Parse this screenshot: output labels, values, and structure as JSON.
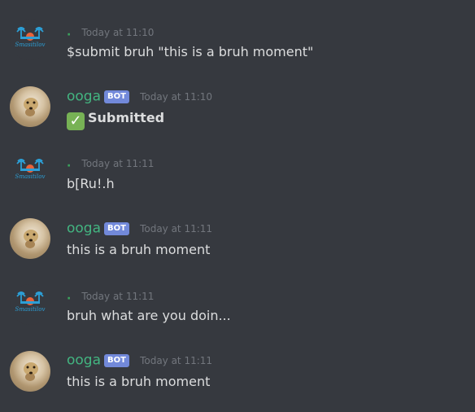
{
  "messages": [
    {
      "author": ".",
      "bot": false,
      "timestamp": "Today at 11:10",
      "content": "$submit bruh \"this is a bruh moment\""
    },
    {
      "author": "ooga",
      "bot": true,
      "bot_tag": "BOT",
      "timestamp": "Today at 11:10",
      "content": "Submitted"
    },
    {
      "author": ".",
      "bot": false,
      "timestamp": "Today at 11:11",
      "content": "b[Ru!.h"
    },
    {
      "author": "ooga",
      "bot": true,
      "bot_tag": "BOT",
      "timestamp": "Today at 11:11",
      "content": "this is a bruh moment"
    },
    {
      "author": ".",
      "bot": false,
      "timestamp": "Today at 11:11",
      "content": "bruh what are you doin..."
    },
    {
      "author": "ooga",
      "bot": true,
      "bot_tag": "BOT",
      "timestamp": "Today at 11:11",
      "content": "this is a bruh moment"
    }
  ],
  "logo_text": "Smasitilov",
  "colors": {
    "background": "#36393f",
    "bot_name": "#43b581",
    "bot_tag": "#7289da",
    "timestamp": "#72767d",
    "check": "#77b255"
  },
  "icons": {
    "check": "white-heavy-check-mark-icon",
    "user_avatar": "palm-trees-sunset-logo-icon",
    "bot_avatar": "dog-avatar-icon"
  }
}
